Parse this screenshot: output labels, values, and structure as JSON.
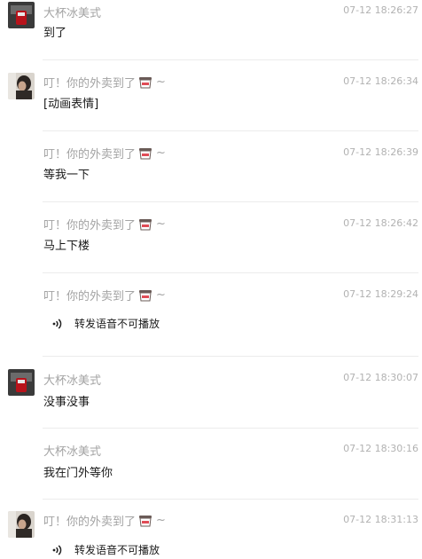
{
  "messages": [
    {
      "sender": "大杯冰美式",
      "time": "07-12 18:26:27",
      "text": "到了",
      "avatar": "avatar-red-mug"
    },
    {
      "sender": "叮！你的外卖到了",
      "emoji_icon": "takeaway-cup-icon",
      "tilde": "~",
      "time": "07-12 18:26:34",
      "text": "[动画表情]",
      "avatar": "avatar-portrait"
    },
    {
      "sender": "叮！你的外卖到了",
      "emoji_icon": "takeaway-cup-icon",
      "tilde": "~",
      "time": "07-12 18:26:39",
      "text": "等我一下"
    },
    {
      "sender": "叮！你的外卖到了",
      "emoji_icon": "takeaway-cup-icon",
      "tilde": "~",
      "time": "07-12 18:26:42",
      "text": "马上下楼"
    },
    {
      "sender": "叮！你的外卖到了",
      "emoji_icon": "takeaway-cup-icon",
      "tilde": "~",
      "time": "07-12 18:29:24",
      "voice_text": "转发语音不可播放"
    },
    {
      "sender": "大杯冰美式",
      "time": "07-12 18:30:07",
      "text": "没事没事",
      "avatar": "avatar-red-mug"
    },
    {
      "sender": "大杯冰美式",
      "time": "07-12 18:30:16",
      "text": "我在门外等你"
    },
    {
      "sender": "叮！你的外卖到了",
      "emoji_icon": "takeaway-cup-icon",
      "tilde": "~",
      "time": "07-12 18:31:13",
      "voice_text": "转发语音不可播放",
      "avatar": "avatar-portrait"
    }
  ],
  "colors": {
    "sender": "#a3a3a3",
    "time": "#b2b2b2",
    "text": "#1a1a1a",
    "divider": "#ececec"
  }
}
